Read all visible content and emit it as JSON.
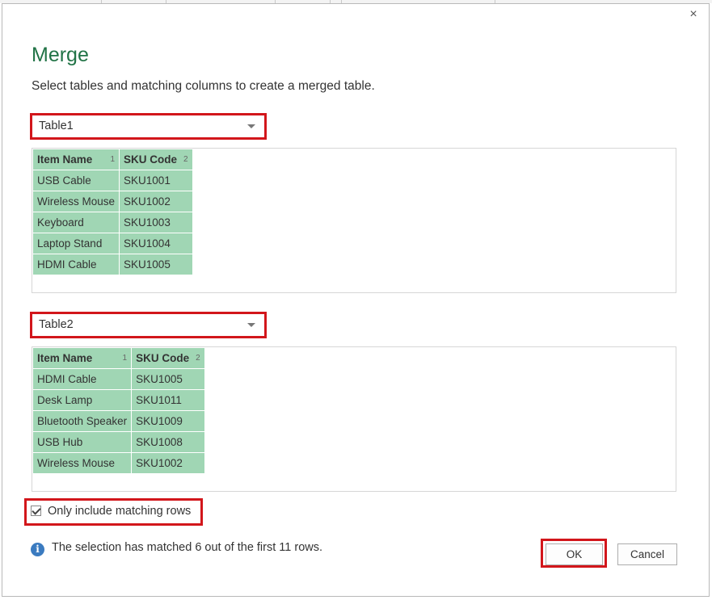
{
  "dialog": {
    "title": "Merge",
    "subtitle": "Select tables and matching columns to create a merged table.",
    "close_label": "×"
  },
  "table1": {
    "selected": "Table1",
    "columns": [
      {
        "name": "Item Name",
        "index": "1"
      },
      {
        "name": "SKU Code",
        "index": "2"
      }
    ],
    "rows": [
      [
        "USB Cable",
        "SKU1001"
      ],
      [
        "Wireless Mouse",
        "SKU1002"
      ],
      [
        "Keyboard",
        "SKU1003"
      ],
      [
        "Laptop Stand",
        "SKU1004"
      ],
      [
        "HDMI Cable",
        "SKU1005"
      ]
    ]
  },
  "table2": {
    "selected": "Table2",
    "columns": [
      {
        "name": "Item Name",
        "index": "1"
      },
      {
        "name": "SKU Code",
        "index": "2"
      }
    ],
    "rows": [
      [
        "HDMI Cable",
        "SKU1005"
      ],
      [
        "Desk Lamp",
        "SKU1011"
      ],
      [
        "Bluetooth Speaker",
        "SKU1009"
      ],
      [
        "USB Hub",
        "SKU1008"
      ],
      [
        "Wireless Mouse",
        "SKU1002"
      ]
    ]
  },
  "options": {
    "only_matching_label": "Only include matching rows",
    "only_matching_checked": true
  },
  "status": {
    "message": "The selection has matched 6 out of the first 11 rows.",
    "icon": "info-icon"
  },
  "buttons": {
    "ok": "OK",
    "cancel": "Cancel"
  },
  "colors": {
    "title": "#217346",
    "column_fill": "#a0d6b4",
    "highlight": "#d2161b"
  }
}
